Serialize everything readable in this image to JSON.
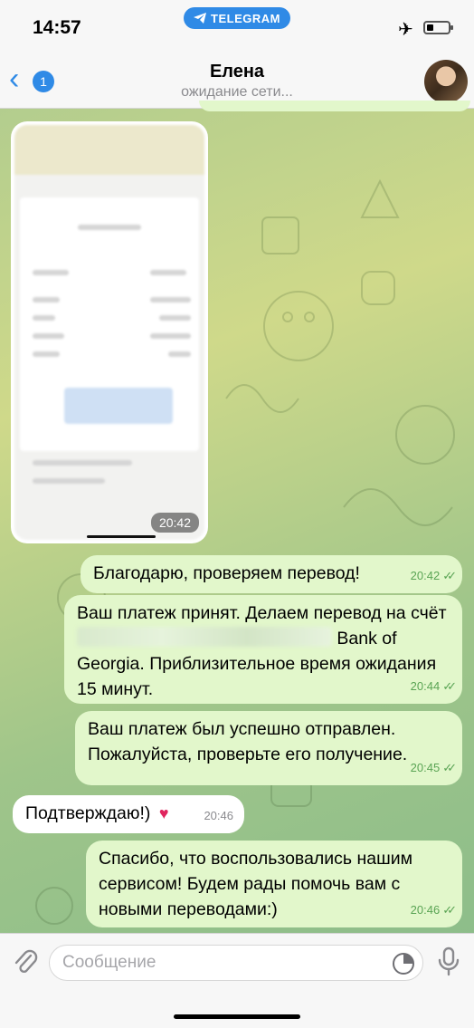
{
  "status_bar": {
    "time": "14:57",
    "app_pill": "TELEGRAM",
    "icons": [
      "airplane-icon",
      "battery-icon"
    ]
  },
  "header": {
    "back_badge": "1",
    "title": "Елена",
    "subtitle": "ожидание сети...",
    "avatar_icon": "avatar"
  },
  "messages": [
    {
      "type": "image",
      "direction": "in",
      "time": "20:42"
    },
    {
      "type": "text",
      "direction": "out",
      "text": "Благодарю, проверяем перевод!",
      "time": "20:42",
      "read": true
    },
    {
      "type": "text",
      "direction": "out",
      "text_pre": "Ваш платеж принят. Делаем перевод на счёт",
      "text_post": "Bank of Georgia. Приблизительное время ожидания 15 минут.",
      "time": "20:44",
      "read": true
    },
    {
      "type": "text",
      "direction": "out",
      "text": "Ваш платеж был успешно отправлен. Пожалуйста, проверьте его получение.",
      "time": "20:45",
      "read": true
    },
    {
      "type": "text",
      "direction": "in",
      "text": "Подтверждаю!)",
      "reaction": "♥",
      "time": "20:46"
    },
    {
      "type": "text",
      "direction": "out",
      "text": "Спасибо, что воспользовались нашим сервисом! Будем рады помочь вам с новыми переводами:)",
      "time": "20:46",
      "read": true
    }
  ],
  "input": {
    "placeholder": "Сообщение",
    "icons": [
      "paperclip-icon",
      "sticker-icon",
      "microphone-icon"
    ]
  },
  "colors": {
    "accent": "#2f8ae6",
    "outgoing_bubble": "#e2f7cb",
    "incoming_bubble": "#ffffff",
    "tick_green": "#5aa454"
  }
}
